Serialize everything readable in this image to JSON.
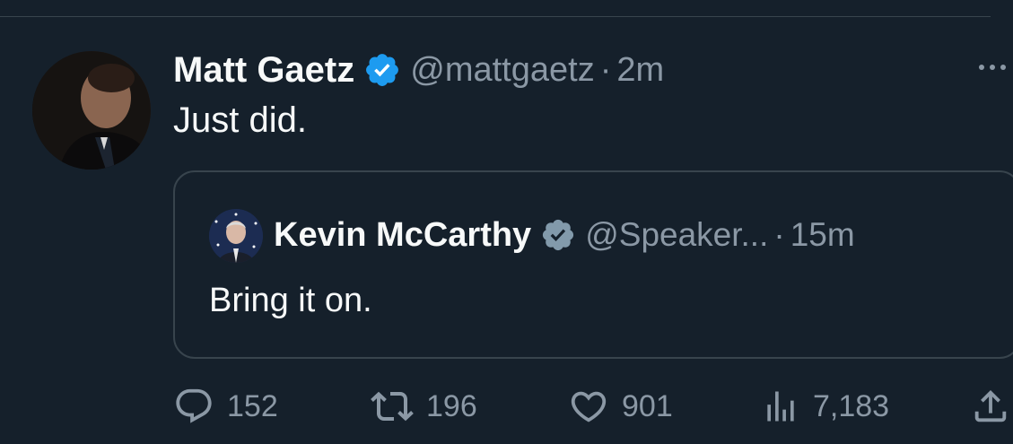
{
  "tweet": {
    "display_name": "Matt Gaetz",
    "handle": "@mattgaetz",
    "separator": "·",
    "time": "2m",
    "text": "Just did."
  },
  "quoted_tweet": {
    "display_name": "Kevin McCarthy",
    "handle": "@Speaker...",
    "separator": "·",
    "time": "15m",
    "text": "Bring it on."
  },
  "actions": {
    "replies": "152",
    "retweets": "196",
    "likes": "901",
    "views": "7,183"
  },
  "colors": {
    "background": "#15202b",
    "text_primary": "#f7f9f9",
    "text_secondary": "#8b98a5",
    "border": "#38444d",
    "verified_blue": "#1d9bf0",
    "verified_gray": "#829aab"
  },
  "icons": {
    "more": "more-icon",
    "reply": "reply-icon",
    "retweet": "retweet-icon",
    "like": "heart-icon",
    "views": "views-icon",
    "share": "share-icon",
    "verified": "verified-badge-icon"
  }
}
